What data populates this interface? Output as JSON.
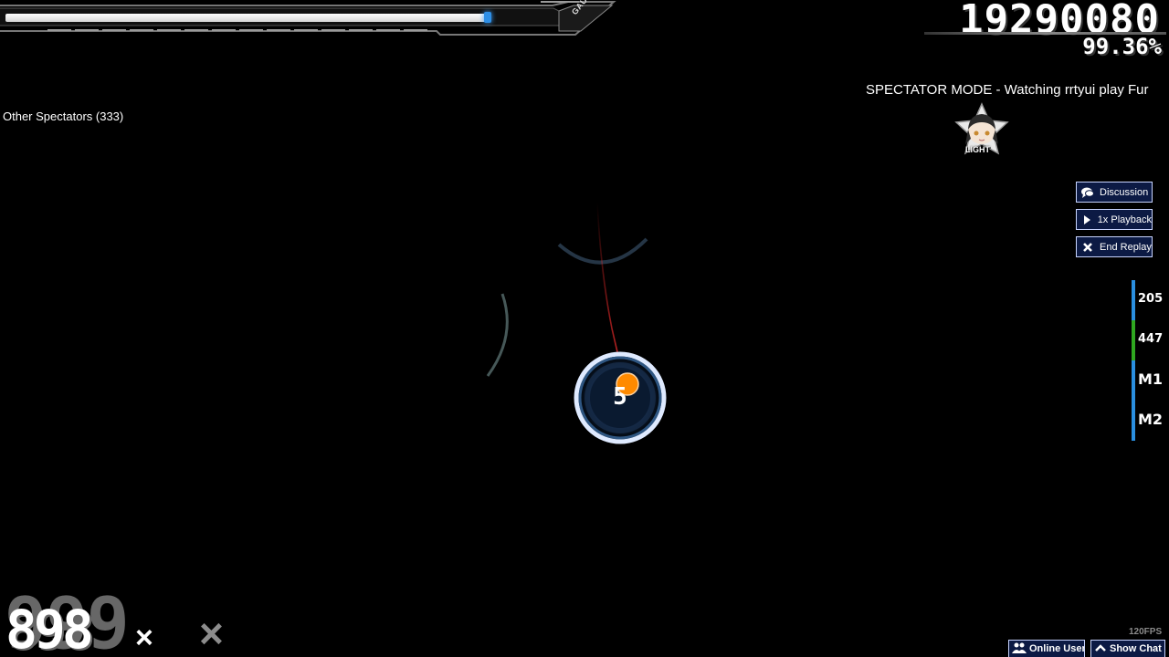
{
  "hud": {
    "gauge_label": "GAUGE",
    "health_fraction": 0.88,
    "score": "19290080",
    "accuracy": "99.36%",
    "combo": "898",
    "combo_shadow": "999",
    "combo_suffix": "×",
    "combo_suffix_shadow": "×",
    "fps": "120FPS"
  },
  "spectator": {
    "mode_text": "SPECTATOR MODE - Watching rrtyui play Fur",
    "other_spectators": "Other Spectators (333)"
  },
  "mods": {
    "label": "LIGHT",
    "icon": "mod-avatar-icon"
  },
  "replay_buttons": [
    {
      "label": "Discussion",
      "icon": "chat-bubble-icon"
    },
    {
      "label": "1x Playback",
      "icon": "play-icon"
    },
    {
      "label": "End Replay",
      "icon": "close-icon"
    }
  ],
  "key_overlay": [
    {
      "label": "205",
      "color": "#2a8fe0"
    },
    {
      "label": "447",
      "color": "#2fa820"
    },
    {
      "label": "M1",
      "color": "#2a8fe0"
    },
    {
      "label": "M2",
      "color": "#2a8fe0"
    }
  ],
  "playfield": {
    "hit_circle_number": "5",
    "cursor_color": "#ff8a00",
    "circle_color": "#cfe3ff"
  },
  "bottom_bar": {
    "online_users": "Online Users",
    "show_chat": "Show Chat"
  }
}
